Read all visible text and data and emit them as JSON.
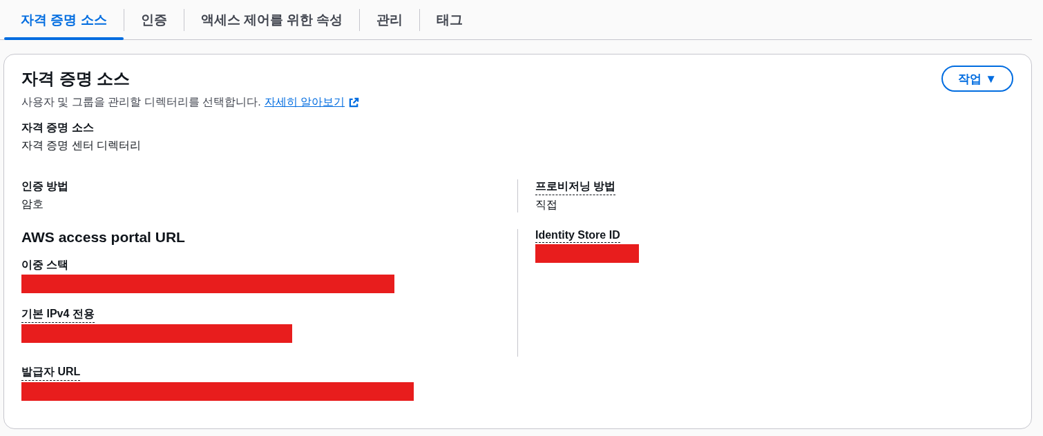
{
  "tabs": [
    {
      "label": "자격 증명 소스",
      "selected": true
    },
    {
      "label": "인증",
      "selected": false
    },
    {
      "label": "액세스 제어를 위한 속성",
      "selected": false
    },
    {
      "label": "관리",
      "selected": false
    },
    {
      "label": "태그",
      "selected": false
    }
  ],
  "panel": {
    "title": "자격 증명 소스",
    "description": "사용자 및 그룹을 관리할 디렉터리를 선택합니다.",
    "learn_more": "자세히 알아보기",
    "action_button": "작업 ▼",
    "source": {
      "label": "자격 증명 소스",
      "value": "자격 증명 센터 디렉터리"
    },
    "rows": [
      {
        "left": {
          "label": "인증 방법",
          "value": "암호",
          "has_info": false
        },
        "right": {
          "label": "프로비저닝 방법",
          "value": "직접",
          "has_info": true
        }
      }
    ],
    "portal": {
      "heading": "AWS access portal URL",
      "fields": [
        {
          "label": "이중 스택",
          "has_info": false,
          "redacted": true
        },
        {
          "label": "기본 IPv4 전용",
          "has_info": true,
          "redacted": true
        },
        {
          "label": "발급자 URL",
          "has_info": true,
          "redacted": true
        }
      ],
      "identity_store": {
        "label": "Identity Store ID",
        "has_info": true,
        "redacted": true
      }
    }
  }
}
